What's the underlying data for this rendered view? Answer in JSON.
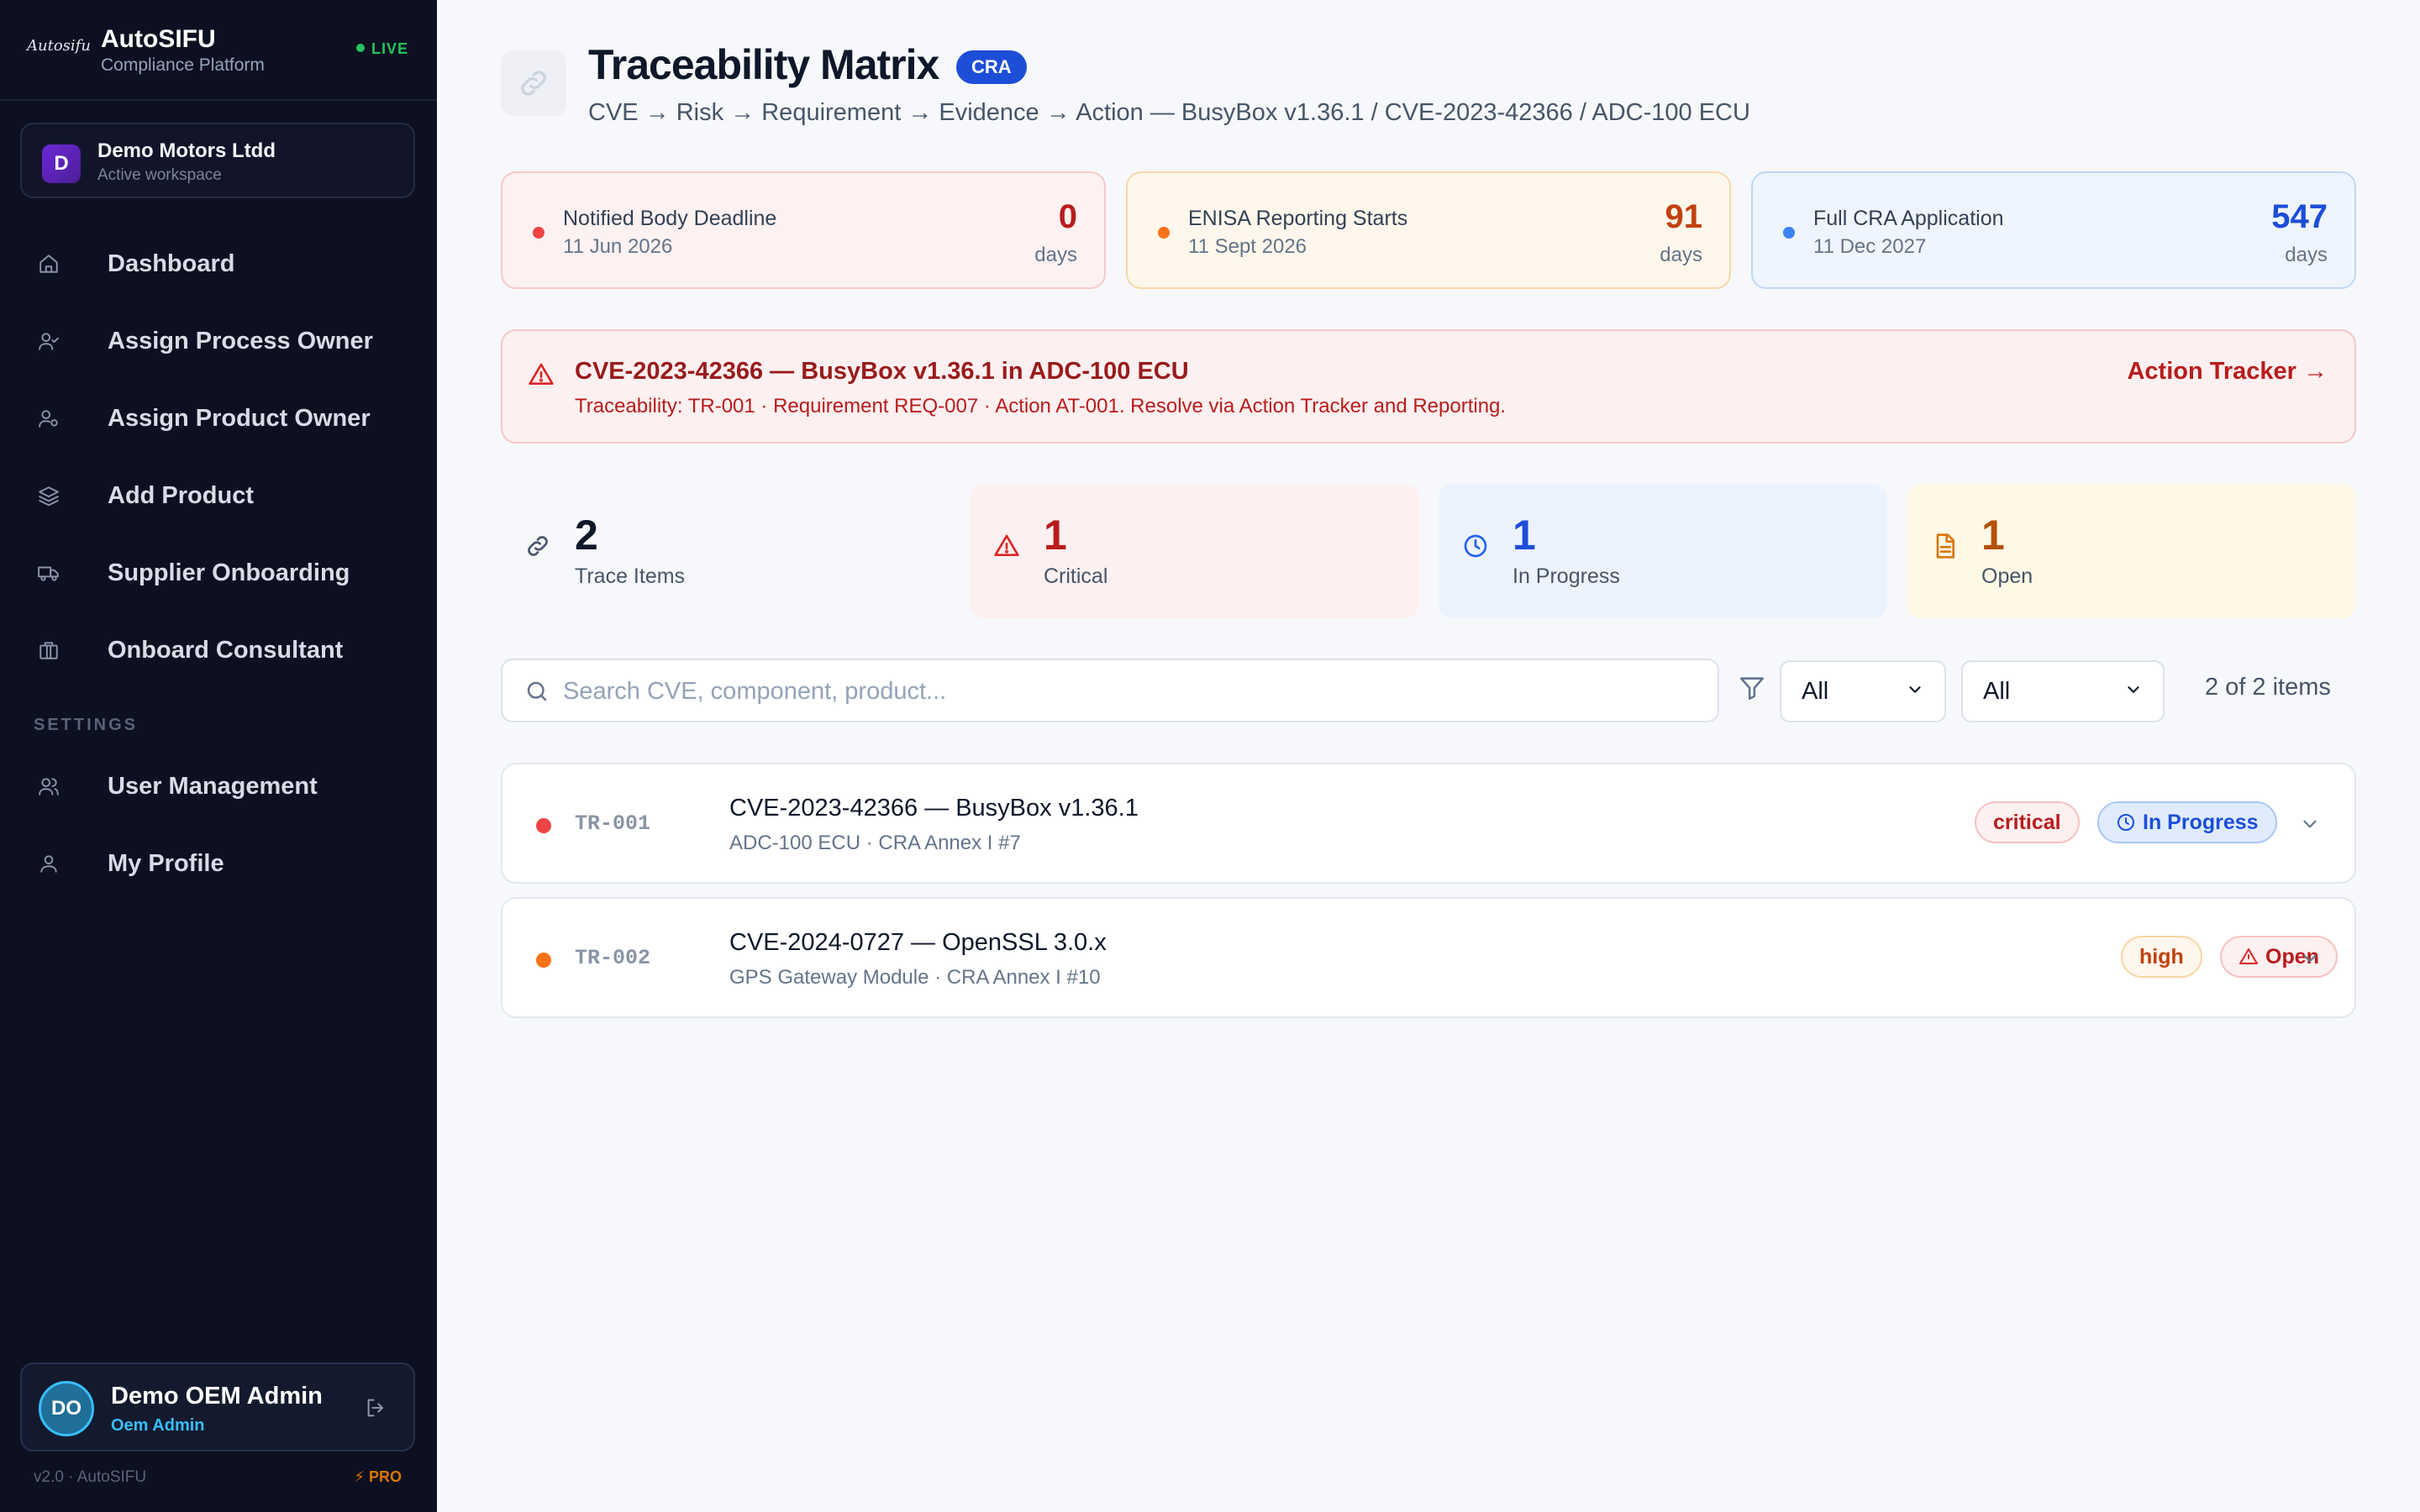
{
  "brand": {
    "logo_text": "Autosifu",
    "name": "AutoSIFU",
    "subtitle": "Compliance Platform",
    "live": "LIVE"
  },
  "workspace": {
    "initial": "D",
    "name": "Demo Motors Ltdd",
    "subtitle": "Active workspace"
  },
  "nav": {
    "items": [
      {
        "label": "Dashboard",
        "icon": "home-icon"
      },
      {
        "label": "Assign Process Owner",
        "icon": "user-check-icon"
      },
      {
        "label": "Assign Product Owner",
        "icon": "user-cog-icon"
      },
      {
        "label": "Add Product",
        "icon": "layers-icon"
      },
      {
        "label": "Supplier Onboarding",
        "icon": "truck-icon"
      },
      {
        "label": "Onboard Consultant",
        "icon": "briefcase-icon"
      }
    ],
    "settings_label": "SETTINGS",
    "settings_items": [
      {
        "label": "User Management",
        "icon": "users-icon"
      },
      {
        "label": "My Profile",
        "icon": "user-icon"
      }
    ]
  },
  "user": {
    "initials": "DO",
    "name": "Demo OEM Admin",
    "role": "Oem Admin"
  },
  "footer": {
    "version": "v2.0 · AutoSIFU",
    "plan": "⚡ PRO"
  },
  "page": {
    "title": "Traceability Matrix",
    "badge": "CRA",
    "subtitle": "CVE → Risk → Requirement → Evidence → Action — BusyBox v1.36.1 / CVE-2023-42366 / ADC-100 ECU"
  },
  "deadlines": [
    {
      "title": "Notified Body Deadline",
      "date": "11 Jun 2026",
      "value": "0",
      "unit": "days",
      "color": "#dc2626"
    },
    {
      "title": "ENISA Reporting Starts",
      "date": "11 Sept 2026",
      "value": "91",
      "unit": "days",
      "color": "#c2410c"
    },
    {
      "title": "Full CRA Application",
      "date": "11 Dec 2027",
      "value": "547",
      "unit": "days",
      "color": "#1d4ed8"
    }
  ],
  "alert": {
    "title": "CVE-2023-42366 — BusyBox v1.36.1 in ADC-100 ECU",
    "text": "Traceability: TR-001 · Requirement REQ-007 · Action AT-001. Resolve via Action Tracker and Reporting.",
    "link": "Action Tracker →"
  },
  "stats": [
    {
      "value": "2",
      "label": "Trace Items"
    },
    {
      "value": "1",
      "label": "Critical"
    },
    {
      "value": "1",
      "label": "In Progress"
    },
    {
      "value": "1",
      "label": "Open"
    }
  ],
  "filters": {
    "search_placeholder": "Search CVE, component, product...",
    "select1": "All",
    "select2": "All",
    "count": "2 of 2 items"
  },
  "rows": [
    {
      "id": "TR-001",
      "title": "CVE-2023-42366 — BusyBox v1.36.1",
      "sub": "ADC-100 ECU · CRA Annex I #7",
      "severity": "critical",
      "status": "In Progress",
      "dot_color": "#ef4444"
    },
    {
      "id": "TR-002",
      "title": "CVE-2024-0727 — OpenSSL 3.0.x",
      "sub": "GPS Gateway Module · CRA Annex I #10",
      "severity": "high",
      "status": "Open",
      "dot_color": "#f97316"
    }
  ]
}
